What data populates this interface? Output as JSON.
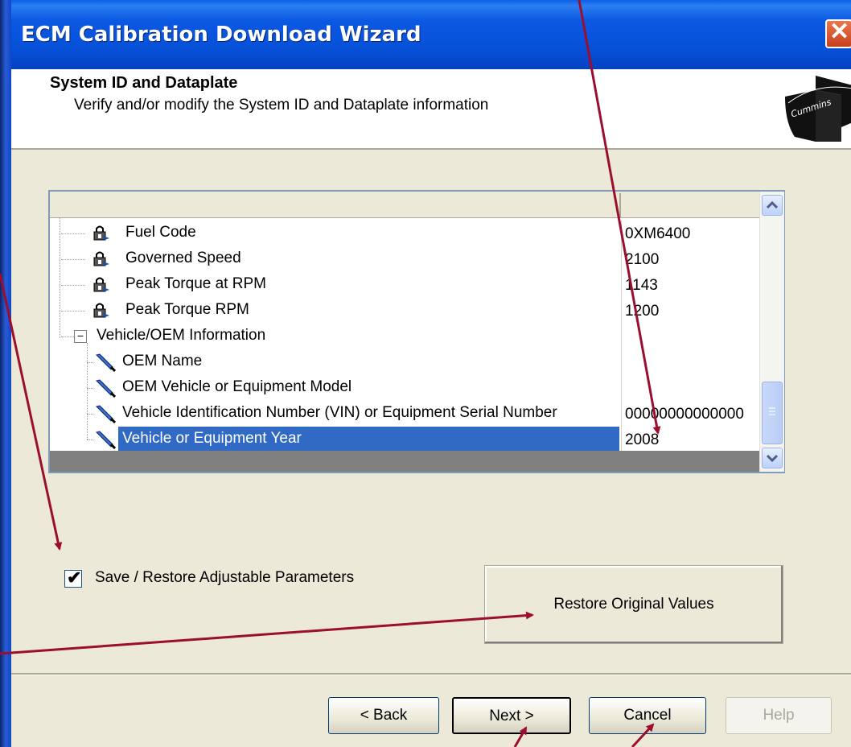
{
  "window": {
    "title": "ECM Calibration Download Wizard"
  },
  "header": {
    "title": "System ID and Dataplate",
    "subtitle": "Verify and/or modify the System ID and Dataplate information",
    "logo_text": "Cummins"
  },
  "grid": {
    "rows": [
      {
        "name": "Fuel Code",
        "value": "0XM6400",
        "icon": "lock-icon"
      },
      {
        "name": "Governed Speed",
        "value": "2100",
        "icon": "lock-icon"
      },
      {
        "name": "Peak Torque at RPM",
        "value": "1143",
        "icon": "lock-icon"
      },
      {
        "name": "Peak Torque RPM",
        "value": "1200",
        "icon": "lock-icon"
      },
      {
        "name": "Vehicle/OEM Information",
        "value": "",
        "icon": "collapse-icon",
        "expand": "−"
      },
      {
        "name": "OEM Name",
        "value": "",
        "icon": "wrench-icon"
      },
      {
        "name": "OEM Vehicle or Equipment Model",
        "value": "",
        "icon": "wrench-icon"
      },
      {
        "name": "Vehicle Identification Number (VIN) or Equipment Serial Number",
        "value": "00000000000000",
        "icon": "wrench-icon"
      },
      {
        "name": "Vehicle or Equipment Year",
        "value": "2008",
        "icon": "wrench-icon",
        "selected": true
      }
    ]
  },
  "checkbox": {
    "label": "Save / Restore Adjustable Parameters",
    "checked": true,
    "mark": "✔"
  },
  "buttons": {
    "restore": "Restore Original Values",
    "back": "< Back",
    "next": "Next >",
    "cancel": "Cancel",
    "help": "Help"
  },
  "colors": {
    "titlebar": "#0751d9",
    "selection": "#316ac5",
    "annotation_arrow": "#9b0e2e"
  }
}
